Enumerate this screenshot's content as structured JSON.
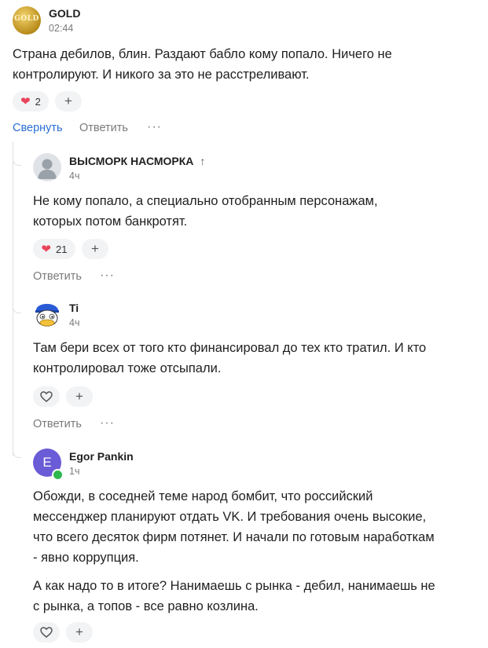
{
  "comments": [
    {
      "author": "GOLD",
      "avatar_text": "GOLD",
      "time": "02:44",
      "paragraphs": [
        "Страна дебилов, блин. Раздают бабло кому попало. Ничего не контролируют. И никого за это не расстреливают."
      ],
      "likes": "2",
      "liked": true,
      "actions": {
        "collapse": "Свернуть",
        "reply": "Ответить",
        "more": "···"
      }
    },
    {
      "author": "ВЫСМОРК НАСМОРКА",
      "author_suffix": "↑",
      "time": "4ч",
      "paragraphs": [
        "Не кому попало, а специально отобранным персонажам, которых потом банкротят."
      ],
      "likes": "21",
      "liked": true,
      "actions": {
        "reply": "Ответить",
        "more": "···"
      }
    },
    {
      "author": "Ti",
      "time": "4ч",
      "paragraphs": [
        "Там бери всех от того кто финансировал до тех кто тратил. И кто контролировал тоже отсыпали."
      ],
      "liked": false,
      "actions": {
        "reply": "Ответить",
        "more": "···"
      }
    },
    {
      "author": "Egor Pankin",
      "avatar_text": "E",
      "time": "1ч",
      "paragraphs": [
        "Обожди, в соседней теме народ бомбит, что российский мессенджер планируют отдать VK. И требования очень высокие, что всего десяток фирм потянет. И начали по готовым наработкам - явно коррупция.",
        "А как надо то в итоге? Нанимаешь с рынка - дебил, нанимаешь не с рынка, а топов - все равно козлина."
      ],
      "liked": false
    }
  ],
  "plus_label": "+",
  "colors": {
    "accent": "#2a6fd6",
    "heart": "#e8445a",
    "online": "#2fb84f",
    "egor_avatar": "#6a5bd6",
    "gold": "#c9a227"
  }
}
